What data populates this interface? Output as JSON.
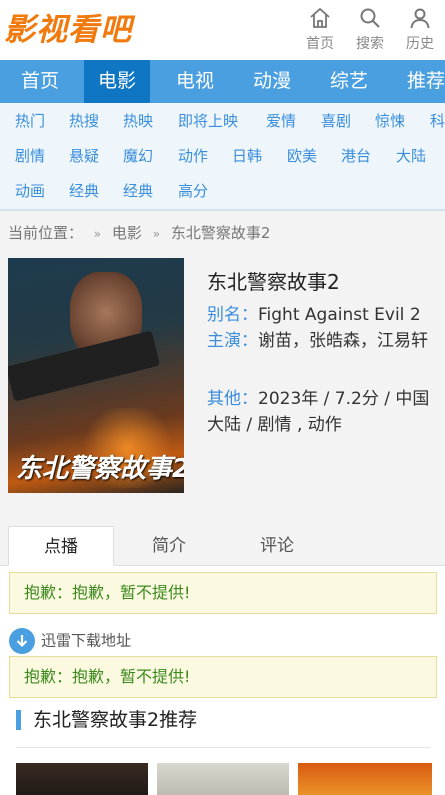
{
  "site": {
    "logo": "影视看吧"
  },
  "header_nav": [
    {
      "label": "首页",
      "icon": "home-icon"
    },
    {
      "label": "搜索",
      "icon": "search-icon"
    },
    {
      "label": "历史",
      "icon": "user-icon"
    }
  ],
  "main_nav": [
    "首页",
    "电影",
    "电视",
    "动漫",
    "综艺",
    "推荐"
  ],
  "main_nav_active": "电影",
  "sub_nav": {
    "row1": [
      "热门",
      "热搜",
      "热映",
      "即将上映",
      "爱情",
      "喜剧",
      "惊悚",
      "科"
    ],
    "row2": [
      "剧情",
      "悬疑",
      "魔幻",
      "动作",
      "日韩",
      "欧美",
      "港台",
      "大陆"
    ],
    "row3": [
      "动画",
      "经典",
      "经典",
      "高分"
    ]
  },
  "breadcrumb": {
    "prefix": "当前位置：",
    "sep": "»",
    "category": "电影",
    "current": "东北警察故事2"
  },
  "movie": {
    "poster_title": "东北警察故事2",
    "title": "东北警察故事2",
    "alias_label": "别名：",
    "alias": "Fight Against Evil 2",
    "cast_label": "主演：",
    "cast": "谢苗，张皓森，江易轩",
    "other_label": "其他：",
    "other": "2023年 / 7.2分 / 中国大陆 / 剧情 , 动作"
  },
  "tabs": [
    "点播",
    "简介",
    "评论"
  ],
  "active_tab": "点播",
  "notice_play": "抱歉：抱歉，暂不提供!",
  "download_label": "迅雷下载地址",
  "notice_download": "抱歉：抱歉，暂不提供!",
  "recommend_title": "东北警察故事2推荐",
  "colors": {
    "brand": "#f07a0d",
    "nav": "#4a9fe0",
    "nav_active": "#0f76c4",
    "notice_text": "#3d8a1e"
  }
}
